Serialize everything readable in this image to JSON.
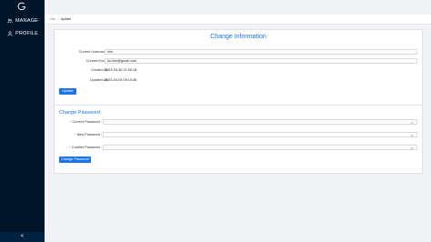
{
  "sidebar": {
    "items": [
      {
        "label": "MANAGE"
      },
      {
        "label": "PROFILE"
      }
    ],
    "collapse_glyph": "<"
  },
  "breadcrumb": {
    "items": [
      "User",
      "Update"
    ],
    "separator": "/"
  },
  "info": {
    "title": "Change Information",
    "username_label": "Current Username :",
    "username_value": "kim",
    "email_label": "Current Email :",
    "email_value": "ko.kim@gmail.com",
    "created_label": "Created At :",
    "created_value": "2023-03-30 21:00:18",
    "updated_label": "Updated At :",
    "updated_value": "2023-04-03 09:15:36",
    "update_button": "Update"
  },
  "password": {
    "title": "Change Password",
    "current_label": "Current Password :",
    "new_label": "New Password :",
    "confirm_label": "Confirm Password :",
    "required_mark": "*",
    "submit_button": "Change Password"
  },
  "colors": {
    "sidebar": "#001529",
    "accent": "#1a73e8",
    "background": "#f0f2f5"
  }
}
